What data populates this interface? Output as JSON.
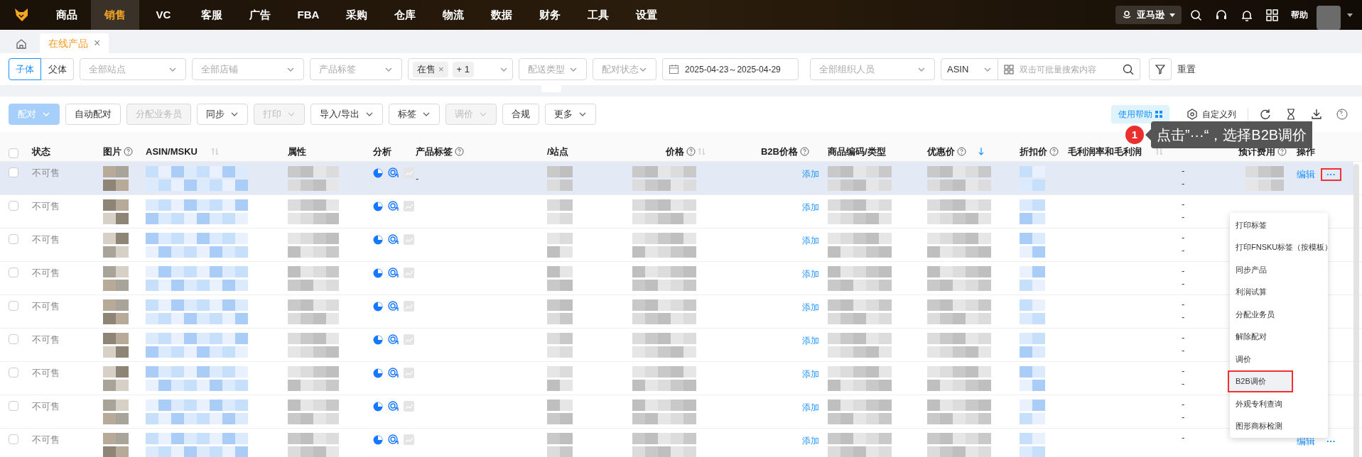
{
  "nav": {
    "items": [
      {
        "label": "商品",
        "selected": false
      },
      {
        "label": "销售",
        "selected": true
      },
      {
        "label": "VC",
        "selected": false
      },
      {
        "label": "客服",
        "selected": false
      },
      {
        "label": "广告",
        "selected": false
      },
      {
        "label": "FBA",
        "selected": false
      },
      {
        "label": "采购",
        "selected": false
      },
      {
        "label": "仓库",
        "selected": false
      },
      {
        "label": "物流",
        "selected": false
      },
      {
        "label": "数据",
        "selected": false
      },
      {
        "label": "财务",
        "selected": false
      },
      {
        "label": "工具",
        "selected": false
      },
      {
        "label": "设置",
        "selected": false
      }
    ],
    "platform": "亚马逊",
    "help": "帮助"
  },
  "page_tabs": [
    {
      "label": "在线产品",
      "selected": true,
      "close": "×"
    }
  ],
  "filters": {
    "segment": [
      {
        "label": "子体",
        "selected": true
      },
      {
        "label": "父体",
        "selected": false
      }
    ],
    "selects": [
      {
        "placeholder": "全部站点"
      },
      {
        "placeholder": "全部店铺"
      },
      {
        "placeholder": "产品标签"
      }
    ],
    "status_select": {
      "tags": [
        {
          "label": "在售",
          "close": "×"
        },
        {
          "label": "+ 1"
        }
      ]
    },
    "selects2": [
      {
        "placeholder": "配送类型"
      },
      {
        "placeholder": "配对状态"
      }
    ],
    "date_range": "2025-04-23～2025-04-29",
    "org_select": {
      "placeholder": "全部组织人员"
    },
    "search_type": "ASIN",
    "search": {
      "placeholder": "双击可批量搜索内容"
    },
    "reset": "重置"
  },
  "toolbar": {
    "buttons": [
      {
        "label": "配对",
        "kind": "primary",
        "disabled": true,
        "dropdown": true
      },
      {
        "label": "自动配对",
        "kind": "default",
        "disabled": false,
        "dropdown": false
      },
      {
        "label": "分配业务员",
        "kind": "default",
        "disabled": true,
        "dropdown": false
      },
      {
        "label": "同步",
        "kind": "default",
        "disabled": false,
        "dropdown": true
      },
      {
        "label": "打印",
        "kind": "default",
        "disabled": true,
        "dropdown": true
      },
      {
        "label": "导入/导出",
        "kind": "default",
        "disabled": false,
        "dropdown": true
      },
      {
        "label": "标签",
        "kind": "default",
        "disabled": false,
        "dropdown": true
      },
      {
        "label": "调价",
        "kind": "default",
        "disabled": true,
        "dropdown": true
      },
      {
        "label": "合规",
        "kind": "default",
        "disabled": false,
        "dropdown": false
      },
      {
        "label": "更多",
        "kind": "default",
        "disabled": false,
        "dropdown": true
      }
    ],
    "help_button": "使用帮助",
    "columns_button": "自定义列"
  },
  "table": {
    "header_checkbox": {
      "checked": false
    },
    "columns": [
      {
        "label": "状态",
        "help": false,
        "sort": false
      },
      {
        "label": "图片",
        "help": true,
        "sort": false
      },
      {
        "label": "ASIN/MSKU",
        "help": false,
        "sort": true
      },
      {
        "label": "属性",
        "help": false,
        "sort": false
      },
      {
        "label": "分析",
        "help": false,
        "sort": false
      },
      {
        "label": "产品标签",
        "help": true,
        "sort": false
      },
      {
        "label": "/站点",
        "help": false,
        "sort": false
      },
      {
        "label": "价格",
        "help": true,
        "sort": true
      },
      {
        "label": "B2B价格",
        "help": true,
        "sort": false
      },
      {
        "label": "商品编码/类型",
        "help": false,
        "sort": false
      },
      {
        "label": "优惠价",
        "help": true,
        "sort": false,
        "sorted": true
      },
      {
        "label": "折扣价",
        "help": true,
        "sort": false
      },
      {
        "label": "毛利润率和毛利润",
        "help": false,
        "sort": true
      },
      {
        "label": "预计费用",
        "help": true,
        "sort": false
      },
      {
        "label": "操作",
        "help": false,
        "sort": false
      }
    ],
    "rows": [
      {
        "status": "不可售",
        "checked": false,
        "selected": true,
        "tag": "-",
        "b2b": "添加",
        "profit": [
          "-",
          "-"
        ],
        "actions": {
          "edit": "编辑",
          "more": "···",
          "outlined": true
        }
      },
      {
        "status": "不可售",
        "checked": false,
        "selected": false,
        "b2b": "添加",
        "profit": [
          "-",
          "-"
        ]
      },
      {
        "status": "不可售",
        "checked": false,
        "selected": false,
        "b2b": "添加",
        "profit": [
          "-",
          "-"
        ]
      },
      {
        "status": "不可售",
        "checked": false,
        "selected": false,
        "b2b": "添加",
        "profit": [
          "-",
          "-"
        ]
      },
      {
        "status": "不可售",
        "checked": false,
        "selected": false,
        "b2b": "添加",
        "profit": [
          "-",
          "-"
        ]
      },
      {
        "status": "不可售",
        "checked": false,
        "selected": false,
        "b2b": "添加",
        "profit": [
          "-",
          "-"
        ]
      },
      {
        "status": "不可售",
        "checked": false,
        "selected": false,
        "b2b": "添加",
        "profit": [
          "-",
          "-"
        ]
      },
      {
        "status": "不可售",
        "checked": false,
        "selected": false,
        "b2b": "添加",
        "profit": [
          "-",
          "-"
        ]
      },
      {
        "status": "不可售",
        "checked": false,
        "selected": false,
        "b2b": "添加",
        "profit": [
          "-"
        ],
        "actions": {
          "edit": "编辑",
          "more": "···",
          "outlined": false
        }
      }
    ]
  },
  "menu": {
    "items": [
      {
        "label": "打印标签",
        "selected": false,
        "outlined": false
      },
      {
        "label": "打印FNSKU标签（按模板）",
        "selected": false,
        "outlined": false
      },
      {
        "label": "同步产品",
        "selected": false,
        "outlined": false
      },
      {
        "label": "利润试算",
        "selected": false,
        "outlined": false
      },
      {
        "label": "分配业务员",
        "selected": false,
        "outlined": false
      },
      {
        "label": "解除配对",
        "selected": false,
        "outlined": false
      },
      {
        "label": "调价",
        "selected": false,
        "outlined": false
      },
      {
        "label": "B2B调价",
        "selected": true,
        "outlined": true
      },
      {
        "label": "外观专利查询",
        "selected": false,
        "outlined": false
      },
      {
        "label": "图形商标检测",
        "selected": false,
        "outlined": false
      }
    ]
  },
  "callout": {
    "step": "1",
    "text": "点击”···“，选择B2B调价"
  }
}
